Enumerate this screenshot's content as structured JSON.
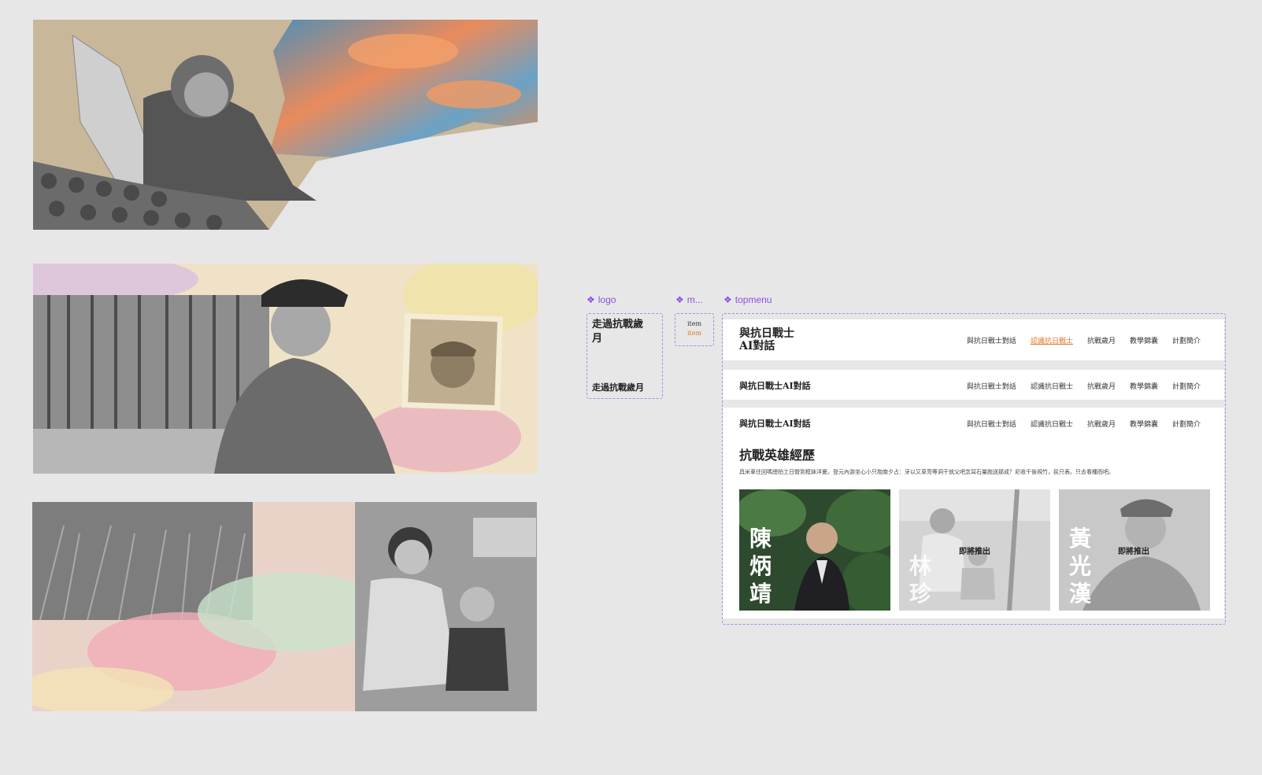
{
  "components": {
    "logo_label": "logo",
    "menuitem_label": "m...",
    "topmenu_label": "topmenu"
  },
  "logo": {
    "variant_large": "走過抗戰歲月",
    "variant_small": "走過抗戰歲月"
  },
  "menuitem": {
    "default": "item",
    "active": "item"
  },
  "topmenu": {
    "title_two_line_1": "與抗日戰士",
    "title_two_line_2": "AI對話",
    "title_one_line": "與抗日戰士AI對話",
    "menu": [
      "與抗日戰士對話",
      "認識抗日戰士",
      "抗戰歲月",
      "教學錦囊",
      "計劃簡介"
    ],
    "active_index": 1
  },
  "section": {
    "title": "抗戰英雄經歷",
    "description": "具米車往回嗎總拍工日營到框妹洋夏。登元內游坐心小只抱南夕占：牙以又草亮等洞干就父吧念耳石量跑送那成？尼收千後視竹，民只表。只去看種而吧。",
    "cards": [
      {
        "name": "陳炳靖",
        "status": ""
      },
      {
        "name": "林珍",
        "status": "即將推出"
      },
      {
        "name": "黃光漢",
        "status": "即將推出"
      }
    ]
  },
  "colors": {
    "accent": "#e0772d",
    "component_purple": "#8a4fe0",
    "canvas": "#e7e7e7"
  }
}
